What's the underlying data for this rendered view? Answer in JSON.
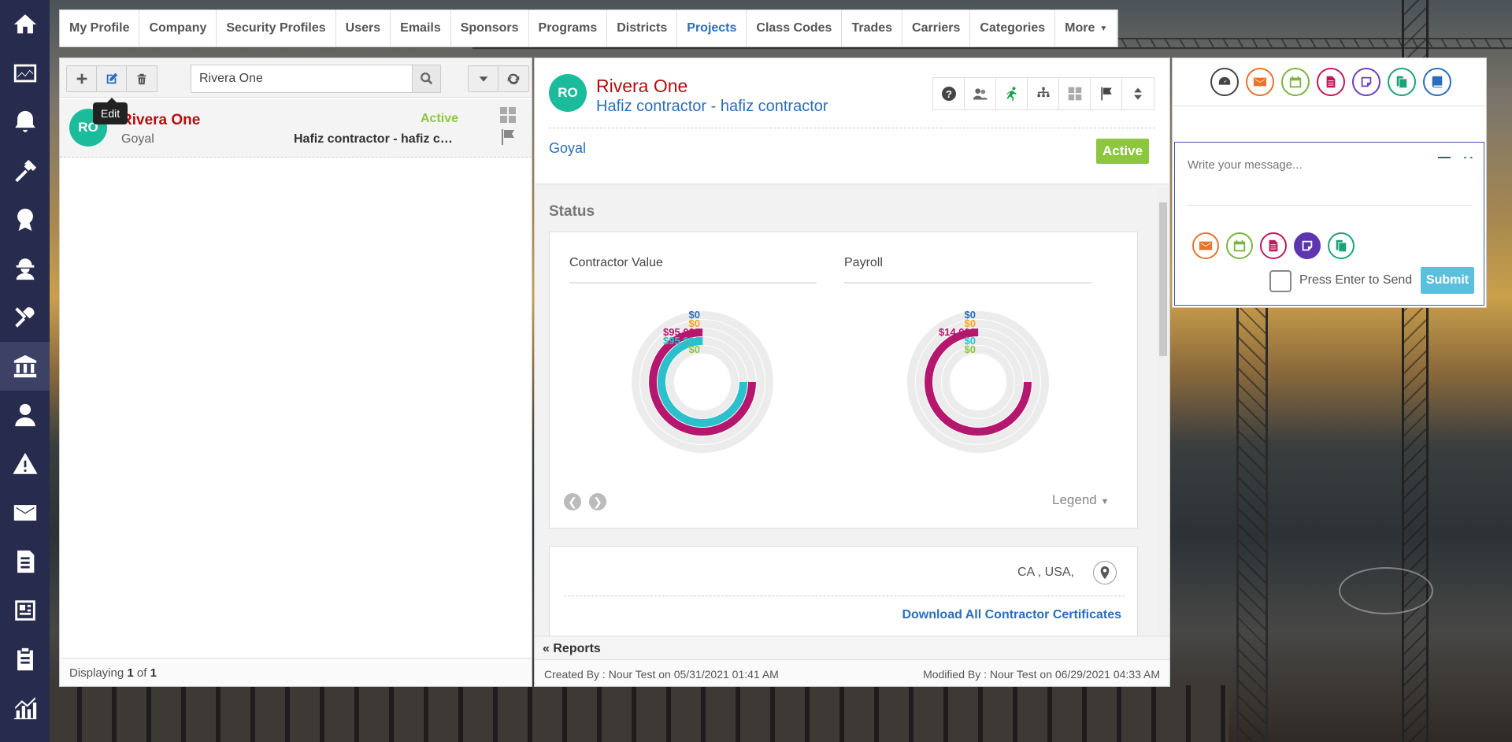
{
  "leftnav": [
    "home-icon",
    "dashboard-chart-icon",
    "bell-icon",
    "hammer-icon",
    "award-icon",
    "worker-icon",
    "tools-icon",
    "bank-icon",
    "user-tie-icon",
    "warning-icon",
    "envelope-icon",
    "document-icon",
    "report-icon",
    "clipboard-icon",
    "analytics-icon"
  ],
  "tabs": [
    "My Profile",
    "Company",
    "Security Profiles",
    "Users",
    "Emails",
    "Sponsors",
    "Programs",
    "Districts",
    "Projects",
    "Class Codes",
    "Trades",
    "Carriers",
    "Categories",
    "More"
  ],
  "left": {
    "search_value": "Rivera One",
    "tooltip": "Edit",
    "row": {
      "avatar": "RO",
      "name": "Rivera One",
      "sub": "Goyal",
      "status": "Active",
      "desc": "Hafiz contractor - hafiz contractor"
    },
    "footer": {
      "prefix": "Displaying ",
      "current": "1",
      "mid": " of ",
      "total": "1"
    }
  },
  "center": {
    "avatar": "RO",
    "title": "Rivera One",
    "subtitle": "Hafiz contractor - hafiz contractor",
    "owner": "Goyal",
    "status": "Active",
    "section": "Status",
    "charts": [
      {
        "title": "Contractor Value",
        "labels": [
          "$0",
          "$0",
          "$95,000",
          "$95,000",
          "$0"
        ],
        "values": [
          0,
          0,
          95000,
          95000,
          0
        ],
        "colors": [
          "#2a6ebb",
          "#f5a623",
          "#b5176f",
          "#2bc0cc",
          "#8dc63f"
        ]
      },
      {
        "title": "Payroll",
        "labels": [
          "$0",
          "$0",
          "$14,000",
          "$0",
          "$0"
        ],
        "values": [
          0,
          0,
          14000,
          0,
          0
        ],
        "colors": [
          "#2a6ebb",
          "#f5a623",
          "#b5176f",
          "#2bc0cc",
          "#8dc63f"
        ]
      }
    ],
    "legend": "Legend",
    "location": "CA , USA,",
    "download": "Download All Contractor Certificates",
    "reports": "Reports",
    "created": "Created By : Nour Test on 05/31/2021 01:41 AM",
    "modified": "Modified By : Nour Test on 06/29/2021 04:33 AM"
  },
  "right": {
    "placeholder": "Write your message...",
    "enter_label": "Press Enter to Send",
    "submit": "Submit"
  }
}
